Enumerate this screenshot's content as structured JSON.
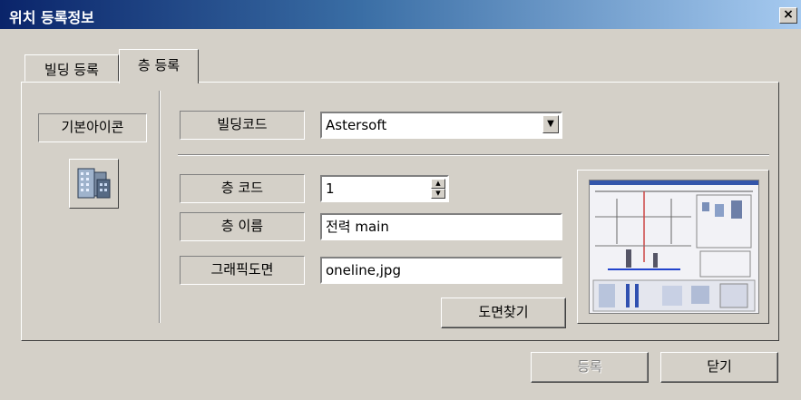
{
  "window": {
    "title": "위치 등록정보",
    "close_label": "×"
  },
  "tabs": [
    {
      "label": "빌딩 등록"
    },
    {
      "label": "층 등록"
    }
  ],
  "icon_section": {
    "label": "기본아이콘",
    "icon": "building-icon"
  },
  "fields": {
    "building_code": {
      "label": "빌딩코드",
      "value": "Astersoft"
    },
    "floor_code": {
      "label": "층 코드",
      "value": "1"
    },
    "floor_name": {
      "label": "층 이름",
      "value": "전력 main"
    },
    "graphic_drawing": {
      "label": "그래픽도면",
      "value": "oneline,jpg"
    }
  },
  "buttons": {
    "find_drawing": "도면찾기",
    "register": "등록",
    "close": "닫기"
  },
  "colors": {
    "face": "#d4d0c8",
    "title_start": "#0a246a",
    "title_end": "#a6caf0"
  }
}
